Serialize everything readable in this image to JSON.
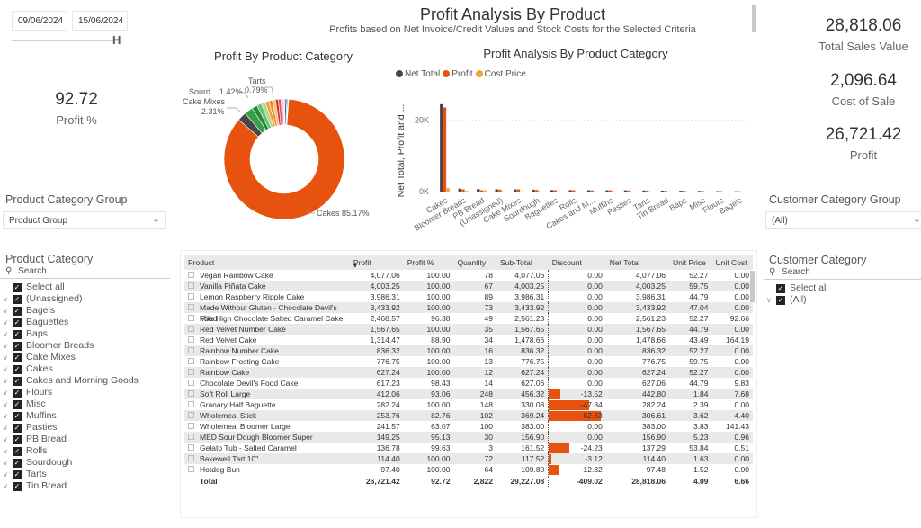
{
  "date_range": {
    "start": "09/06/2024",
    "end": "15/06/2024"
  },
  "header": {
    "title": "Profit Analysis By Product",
    "subtitle": "Profits based on Net Invoice/Credit Values and Stock Costs for the Selected Criteria"
  },
  "kpis": {
    "profit_pct": {
      "value": "92.72",
      "label": "Profit %"
    },
    "total_sales": {
      "value": "28,818.06",
      "label": "Total Sales Value"
    },
    "cost_of_sale": {
      "value": "2,096.64",
      "label": "Cost of Sale"
    },
    "profit": {
      "value": "26,721.42",
      "label": "Profit"
    }
  },
  "chart_data": [
    {
      "type": "pie",
      "title": "Profit By Product Category",
      "donut": true,
      "slices": [
        {
          "label": "Cakes",
          "value": 85.17,
          "color": "#e8520f"
        },
        {
          "label": "Bloomer Breads",
          "value": 2.4,
          "color": "#4a4549"
        },
        {
          "label": "Cake Mixes",
          "value": 2.31,
          "color": "#35a047"
        },
        {
          "label": "Sourdough",
          "value": 1.42,
          "color": "#248a38"
        },
        {
          "label": "PB Bread",
          "value": 1.3,
          "color": "#6cc26a"
        },
        {
          "label": "(Unassigned)",
          "value": 1.1,
          "color": "#a8d99a"
        },
        {
          "label": "Baguettes",
          "value": 1.0,
          "color": "#f4a234"
        },
        {
          "label": "Rolls",
          "value": 0.9,
          "color": "#f0882a"
        },
        {
          "label": "Cakes and Morning Goods",
          "value": 0.85,
          "color": "#f7c27a"
        },
        {
          "label": "Tarts",
          "value": 0.79,
          "color": "#d32f2f"
        },
        {
          "label": "Muffins",
          "value": 0.7,
          "color": "#e05060"
        },
        {
          "label": "Pasties",
          "value": 0.6,
          "color": "#f2a0a8"
        },
        {
          "label": "Tin Bread",
          "value": 0.5,
          "color": "#f7d0d4"
        },
        {
          "label": "Baps",
          "value": 0.45,
          "color": "#1f5fa0"
        },
        {
          "label": "Misc",
          "value": 0.3,
          "color": "#4a90d9"
        },
        {
          "label": "Flours",
          "value": 0.12,
          "color": "#9cc4ea"
        },
        {
          "label": "Bagels",
          "value": 0.09,
          "color": "#c7ddf2"
        }
      ],
      "data_labels": [
        {
          "label": "Cakes 85.17%"
        },
        {
          "label": "Cake Mixes",
          "sub": "2.31%"
        },
        {
          "label": "Sourd... 1.42%"
        },
        {
          "label": "Tarts",
          "sub": "0.79%"
        }
      ]
    },
    {
      "type": "bar",
      "title": "Profit Analysis By Product Category",
      "ylabel": "Net Total, Profit and ...",
      "xlabel": "",
      "ylim": [
        0,
        28000
      ],
      "yticks": [
        {
          "v": 0,
          "label": "0K"
        },
        {
          "v": 20000,
          "label": "20K"
        }
      ],
      "grid": true,
      "legend_position": "top-left",
      "categories": [
        "Cakes",
        "Bloomer Breads",
        "PB Bread",
        "(Unassigned)",
        "Cake Mixes",
        "Sourdough",
        "Baguettes",
        "Rolls",
        "Cakes and M...",
        "Muffins",
        "Pasties",
        "Tarts",
        "Tin Bread",
        "Baps",
        "Misc",
        "Flours",
        "Bagels"
      ],
      "series": [
        {
          "name": "Net Total",
          "color": "#4a4549",
          "values": [
            24500,
            820,
            700,
            640,
            620,
            540,
            420,
            400,
            380,
            360,
            340,
            300,
            260,
            240,
            180,
            120,
            90
          ]
        },
        {
          "name": "Profit",
          "color": "#e8520f",
          "values": [
            23600,
            640,
            380,
            560,
            620,
            440,
            360,
            360,
            330,
            320,
            300,
            280,
            230,
            220,
            160,
            110,
            80
          ]
        },
        {
          "name": "Cost Price",
          "color": "#f4a234",
          "values": [
            950,
            200,
            320,
            90,
            60,
            110,
            70,
            50,
            60,
            50,
            50,
            30,
            40,
            30,
            20,
            10,
            10
          ]
        }
      ]
    }
  ],
  "slicers": {
    "product_category_group": {
      "title": "Product Category Group",
      "value": "Product Group"
    },
    "customer_category_group": {
      "title": "Customer Category Group",
      "value": "(All)"
    },
    "product_category": {
      "title": "Product Category",
      "search_placeholder": "Search",
      "select_all": "Select all",
      "items": [
        "(Unassigned)",
        "Bagels",
        "Baguettes",
        "Baps",
        "Bloomer Breads",
        "Cake Mixes",
        "Cakes",
        "Cakes and Morning Goods",
        "Flours",
        "Misc",
        "Muffins",
        "Pasties",
        "PB Bread",
        "Rolls",
        "Sourdough",
        "Tarts",
        "Tin Bread"
      ]
    },
    "customer_category": {
      "title": "Customer Category",
      "search_placeholder": "Search",
      "select_all": "Select all",
      "items": [
        "(All)"
      ]
    }
  },
  "table": {
    "columns": [
      "Product",
      "Profit",
      "Profit %",
      "Quantity",
      "Sub-Total",
      "Discount",
      "Net Total",
      "Unit Price",
      "Unit Cost"
    ],
    "sort_column": "Profit",
    "discount_bar_color": "#e8520f",
    "rows": [
      {
        "product": "Vegan Rainbow Cake",
        "profit": "4,077.06",
        "profit_pct": "100.00",
        "qty": "78",
        "subtotal": "4,077.06",
        "discount": "0.00",
        "discount_num": 0,
        "net": "4,077.06",
        "unit_price": "52.27",
        "unit_cost": "0.00"
      },
      {
        "product": "Vanilla Piñata Cake",
        "profit": "4,003.25",
        "profit_pct": "100.00",
        "qty": "67",
        "subtotal": "4,003.25",
        "discount": "0.00",
        "discount_num": 0,
        "net": "4,003.25",
        "unit_price": "59.75",
        "unit_cost": "0.00"
      },
      {
        "product": "Lemon Raspberry Ripple Cake",
        "profit": "3,986.31",
        "profit_pct": "100.00",
        "qty": "89",
        "subtotal": "3,986.31",
        "discount": "0.00",
        "discount_num": 0,
        "net": "3,986.31",
        "unit_price": "44.79",
        "unit_cost": "0.00"
      },
      {
        "product": "Made Without Gluten - Chocolate Devil's Food",
        "profit": "3,433.92",
        "profit_pct": "100.00",
        "qty": "73",
        "subtotal": "3,433.92",
        "discount": "0.00",
        "discount_num": 0,
        "net": "3,433.92",
        "unit_price": "47.04",
        "unit_cost": "0.00"
      },
      {
        "product": "Mile High Chocolate Salted Caramel Cake",
        "profit": "2,468.57",
        "profit_pct": "96.38",
        "qty": "49",
        "subtotal": "2,561.23",
        "discount": "0.00",
        "discount_num": 0,
        "net": "2,561.23",
        "unit_price": "52.27",
        "unit_cost": "92.66"
      },
      {
        "product": "Red Velvet Number Cake",
        "profit": "1,567.65",
        "profit_pct": "100.00",
        "qty": "35",
        "subtotal": "1,567.65",
        "discount": "0.00",
        "discount_num": 0,
        "net": "1,567.65",
        "unit_price": "44.79",
        "unit_cost": "0.00"
      },
      {
        "product": "Red Velvet Cake",
        "profit": "1,314.47",
        "profit_pct": "88.90",
        "qty": "34",
        "subtotal": "1,478.66",
        "discount": "0.00",
        "discount_num": 0,
        "net": "1,478.66",
        "unit_price": "43.49",
        "unit_cost": "164.19"
      },
      {
        "product": "Rainbow Number Cake",
        "profit": "836.32",
        "profit_pct": "100.00",
        "qty": "16",
        "subtotal": "836.32",
        "discount": "0.00",
        "discount_num": 0,
        "net": "836.32",
        "unit_price": "52.27",
        "unit_cost": "0.00"
      },
      {
        "product": "Rainbow Frosting Cake",
        "profit": "776.75",
        "profit_pct": "100.00",
        "qty": "13",
        "subtotal": "776.75",
        "discount": "0.00",
        "discount_num": 0,
        "net": "776.75",
        "unit_price": "59.75",
        "unit_cost": "0.00"
      },
      {
        "product": "Rainbow Cake",
        "profit": "627.24",
        "profit_pct": "100.00",
        "qty": "12",
        "subtotal": "627.24",
        "discount": "0.00",
        "discount_num": 0,
        "net": "627.24",
        "unit_price": "52.27",
        "unit_cost": "0.00"
      },
      {
        "product": "Chocolate Devil's Food Cake",
        "profit": "617.23",
        "profit_pct": "98.43",
        "qty": "14",
        "subtotal": "627.06",
        "discount": "0.00",
        "discount_num": 0,
        "net": "627.06",
        "unit_price": "44.79",
        "unit_cost": "9.83"
      },
      {
        "product": "Soft Roll Large",
        "profit": "412.06",
        "profit_pct": "93.06",
        "qty": "248",
        "subtotal": "456.32",
        "discount": "-13.52",
        "discount_num": -13.52,
        "net": "442.80",
        "unit_price": "1.84",
        "unit_cost": "7.68"
      },
      {
        "product": "Granary Half Baguette",
        "profit": "282.24",
        "profit_pct": "100.00",
        "qty": "148",
        "subtotal": "330.08",
        "discount": "-47.84",
        "discount_num": -47.84,
        "net": "282.24",
        "unit_price": "2.39",
        "unit_cost": "0.00"
      },
      {
        "product": "Wholemeal Stick",
        "profit": "253.76",
        "profit_pct": "82.76",
        "qty": "102",
        "subtotal": "369.24",
        "discount": "-62.63",
        "discount_num": -62.63,
        "net": "306.61",
        "unit_price": "3.62",
        "unit_cost": "4.40"
      },
      {
        "product": "Wholemeal Bloomer Large",
        "profit": "241.57",
        "profit_pct": "63.07",
        "qty": "100",
        "subtotal": "383.00",
        "discount": "0.00",
        "discount_num": 0,
        "net": "383.00",
        "unit_price": "3.83",
        "unit_cost": "141.43"
      },
      {
        "product": "MED Sour Dough Bloomer Super",
        "profit": "149.25",
        "profit_pct": "95.13",
        "qty": "30",
        "subtotal": "156.90",
        "discount": "0.00",
        "discount_num": 0,
        "net": "156.90",
        "unit_price": "5.23",
        "unit_cost": "0.96"
      },
      {
        "product": "Gelato Tub - Salted Caramel",
        "profit": "136.78",
        "profit_pct": "99.63",
        "qty": "3",
        "subtotal": "161.52",
        "discount": "-24.23",
        "discount_num": -24.23,
        "net": "137.29",
        "unit_price": "53.84",
        "unit_cost": "0.51"
      },
      {
        "product": "Bakewell Tart 10\"",
        "profit": "114.40",
        "profit_pct": "100.00",
        "qty": "72",
        "subtotal": "117.52",
        "discount": "-3.12",
        "discount_num": -3.12,
        "net": "114.40",
        "unit_price": "1.63",
        "unit_cost": "0.00"
      },
      {
        "product": "Hotdog Bun",
        "profit": "97.40",
        "profit_pct": "100.00",
        "qty": "64",
        "subtotal": "109.80",
        "discount": "-12.32",
        "discount_num": -12.32,
        "net": "97.48",
        "unit_price": "1.52",
        "unit_cost": "0.00"
      }
    ],
    "total": {
      "label": "Total",
      "profit": "26,721.42",
      "profit_pct": "92.72",
      "qty": "2,822",
      "subtotal": "29,227.08",
      "discount": "-409.02",
      "net": "28,818.06",
      "unit_price": "4.09",
      "unit_cost": "6.66"
    }
  }
}
